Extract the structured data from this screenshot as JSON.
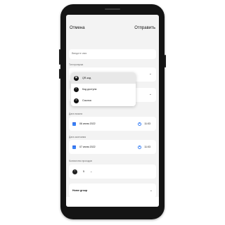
{
  "header": {
    "cancel_label": "Отмена",
    "send_label": "Отправить"
  },
  "name_field": {
    "placeholder": "Введите имя"
  },
  "pass_type": {
    "caption": "Тип пропуска",
    "options": [
      {
        "label": "QR-код",
        "icon": "qr-code-icon",
        "selected": true
      },
      {
        "label": "Код доступа",
        "icon": "keypad-icon",
        "selected": false
      },
      {
        "label": "Ссылка",
        "icon": "link-icon",
        "selected": false
      }
    ]
  },
  "start": {
    "caption": "Дата начала",
    "date": "06 июня 2022",
    "time": "11:03"
  },
  "end": {
    "caption": "Дата окончания",
    "date": "07 июня 2022",
    "time": "11:03"
  },
  "passes": {
    "caption": "Количество проходов",
    "value": "5"
  },
  "group": {
    "label": "Home group"
  },
  "colors": {
    "accent": "#3b82f6",
    "phone_body": "#141414",
    "screen_bg": "#f3f3f3",
    "card_bg": "#ffffff"
  }
}
